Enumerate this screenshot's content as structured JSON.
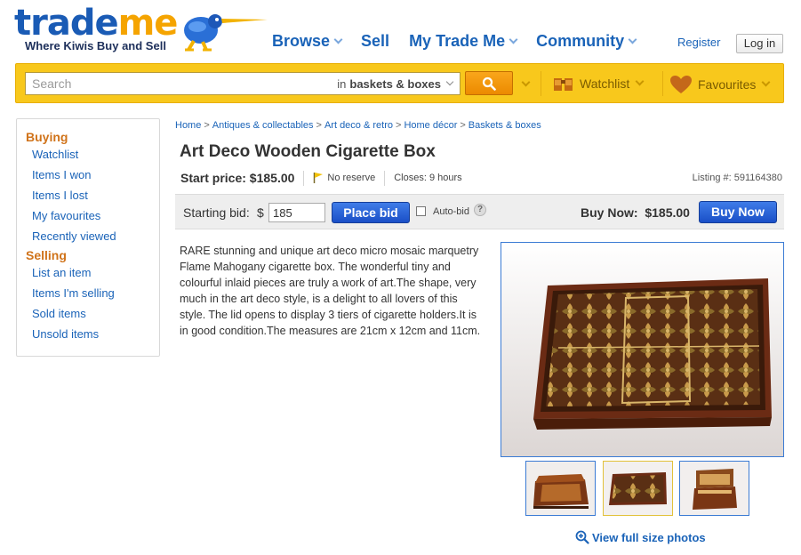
{
  "brand": {
    "logo_trade": "trade",
    "logo_me": "me",
    "tagline": "Where Kiwis Buy and Sell"
  },
  "topnav": {
    "items": [
      {
        "label": "Browse",
        "dropdown": true
      },
      {
        "label": "Sell",
        "dropdown": false
      },
      {
        "label": "My Trade Me",
        "dropdown": true
      },
      {
        "label": "Community",
        "dropdown": true
      }
    ],
    "register": "Register",
    "login": "Log in"
  },
  "search": {
    "placeholder": "Search",
    "scope_prefix": "in",
    "scope_value": "baskets & boxes",
    "search_icon": "magnifier-icon",
    "watchlist_label": "Watchlist",
    "favourites_label": "Favourites"
  },
  "sidebar": {
    "buying_heading": "Buying",
    "buying_items": [
      "Watchlist",
      "Items I won",
      "Items I lost",
      "My favourites",
      "Recently viewed"
    ],
    "selling_heading": "Selling",
    "selling_items": [
      "List an item",
      "Items I'm selling",
      "Sold items",
      "Unsold items"
    ]
  },
  "breadcrumb": [
    "Home",
    "Antiques & collectables",
    "Art deco & retro",
    "Home décor",
    "Baskets & boxes"
  ],
  "listing": {
    "title": "Art Deco Wooden Cigarette Box",
    "start_price": "Start price: $185.00",
    "reserve": "No reserve",
    "closes": "Closes: 9 hours",
    "listing_number": "Listing #: 591164380"
  },
  "bid": {
    "starting_bid_label": "Starting bid:",
    "currency": "$",
    "bid_value": "185",
    "place_bid": "Place bid",
    "autobid_label": "Auto-bid",
    "help": "?",
    "buy_now_label": "Buy Now:  $185.00",
    "buy_now_button": "Buy Now"
  },
  "description": "RARE stunning and unique art deco micro mosaic marquetry Flame Mahogany cigarette box. The wonderful tiny and colourful inlaid pieces are truly a work of art.The shape, very much in the art deco style, is a delight to all lovers of this style. The lid opens to display 3 tiers of cigarette holders.It is in good condition.The measures are 21cm x 12cm and 11cm.",
  "photos": {
    "view_full": "View full size photos",
    "selected_thumbnail": 2
  },
  "colors": {
    "brand_blue": "#1a5bb5",
    "brand_orange": "#f5a400",
    "link_blue": "#1a63b8",
    "search_bar_yellow": "#f8c81c",
    "button_blue": "#1a4fc7",
    "sidebar_heading": "#d0731a"
  }
}
